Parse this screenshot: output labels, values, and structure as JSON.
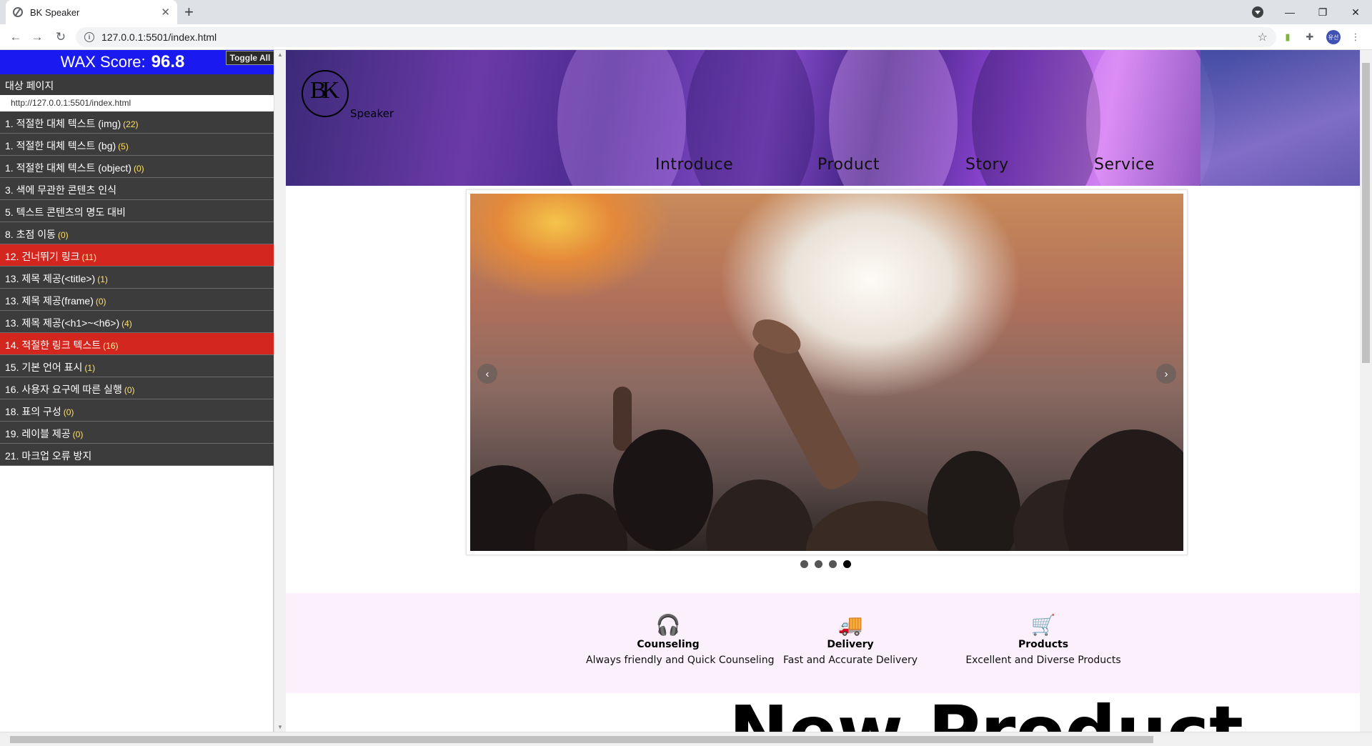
{
  "browser": {
    "tab_title": "BK Speaker",
    "url": "127.0.0.1:5501/index.html",
    "profile_initials": "유선"
  },
  "wax": {
    "score_label": "WAX Score:",
    "score_value": "96.8",
    "toggle_all": "Toggle All",
    "target_label": "대상 페이지",
    "target_url": "http://127.0.0.1:5501/index.html",
    "items": [
      {
        "label": "1. 적절한 대체 텍스트 (img)",
        "count": "(22)",
        "error": false
      },
      {
        "label": "1. 적절한 대체 텍스트 (bg)",
        "count": "(5)",
        "error": false
      },
      {
        "label": "1. 적절한 대체 텍스트 (object)",
        "count": "(0)",
        "error": false
      },
      {
        "label": "3. 색에 무관한 콘텐츠 인식",
        "count": "",
        "error": false
      },
      {
        "label": "5. 텍스트 콘텐츠의 명도 대비",
        "count": "",
        "error": false
      },
      {
        "label": "8. 초점 이동",
        "count": "(0)",
        "error": false
      },
      {
        "label": "12. 건너뛰기 링크",
        "count": "(11)",
        "error": true
      },
      {
        "label": "13. 제목 제공(<title>)",
        "count": "(1)",
        "error": false
      },
      {
        "label": "13. 제목 제공(frame)",
        "count": "(0)",
        "error": false
      },
      {
        "label": "13. 제목 제공(<h1>~<h6>)",
        "count": "(4)",
        "error": false
      },
      {
        "label": "14. 적절한 링크 텍스트",
        "count": "(16)",
        "error": true
      },
      {
        "label": "15. 기본 언어 표시",
        "count": "(1)",
        "error": false
      },
      {
        "label": "16. 사용자 요구에 따른 실행",
        "count": "(0)",
        "error": false
      },
      {
        "label": "18. 표의 구성",
        "count": "(0)",
        "error": false
      },
      {
        "label": "19. 레이블 제공",
        "count": "(0)",
        "error": false
      },
      {
        "label": "21. 마크업 오류 방지",
        "count": "",
        "error": false
      }
    ],
    "colors": {
      "score_bg": "#1a1af0",
      "item_bg": "#3c3c3c",
      "error_bg": "#d3261e"
    }
  },
  "site": {
    "logo_glyph": "BK",
    "logo_text": "Speaker",
    "nav": [
      "Introduce",
      "Product",
      "Story",
      "Service"
    ],
    "slider": {
      "prev_icon": "chevron-left-icon",
      "next_icon": "chevron-right-icon",
      "slide_count": 4,
      "active_slide": 4
    },
    "features": [
      {
        "icon": "headset-icon",
        "glyph": "🎧",
        "name": "Counseling",
        "desc": "Always friendly and Quick Counseling"
      },
      {
        "icon": "truck-icon",
        "glyph": "🚚",
        "name": "Delivery",
        "desc": "Fast and Accurate Delivery"
      },
      {
        "icon": "cart-icon",
        "glyph": "🛒",
        "name": "Products",
        "desc": "Excellent and Diverse Products"
      }
    ],
    "section_heading": "New Product"
  }
}
